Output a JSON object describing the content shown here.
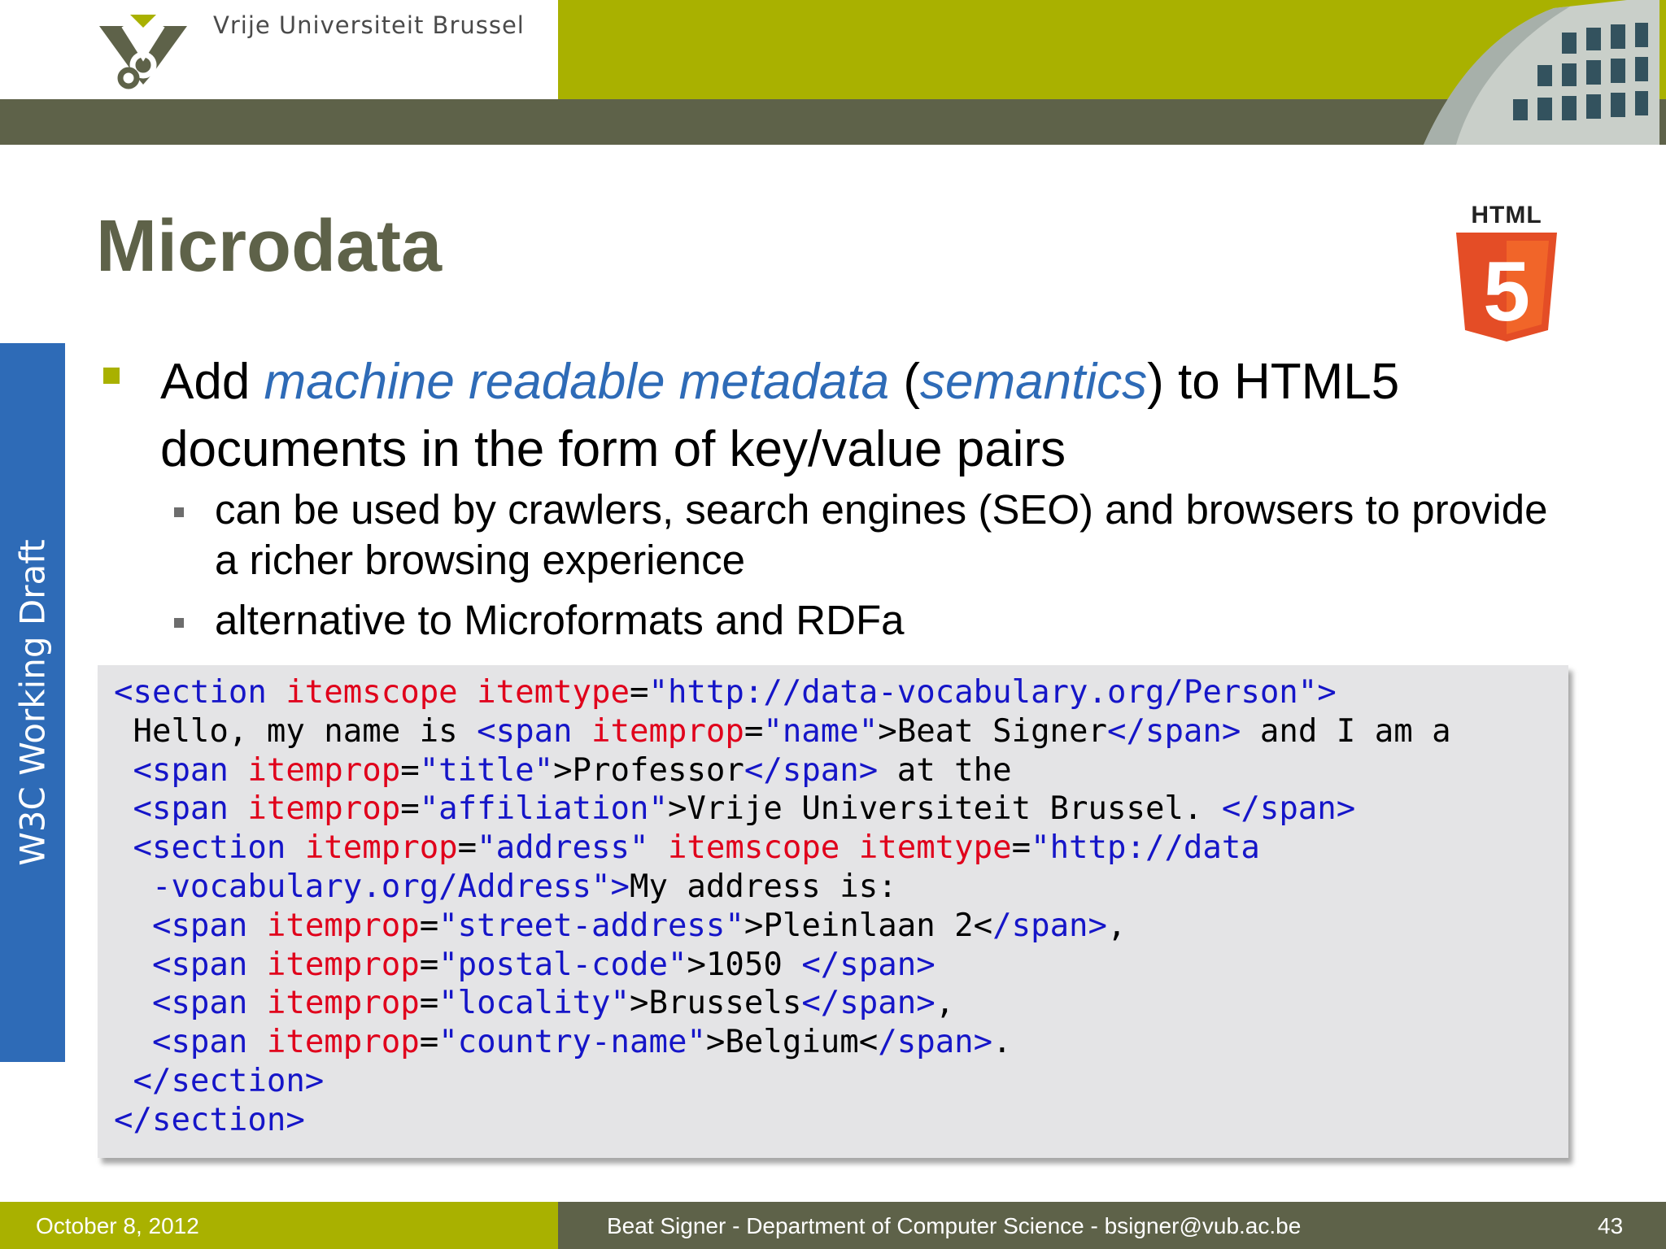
{
  "header": {
    "university_name": "Vrije Universiteit  Brussel",
    "logo_icon": "vub-logo-icon",
    "building_image": "building-photo-icon"
  },
  "slide": {
    "title": "Microdata",
    "side_tab": "W3C Working Draft",
    "html5_logo_text": "HTML",
    "html5_logo_number": "5",
    "bullet": {
      "part1": "Add ",
      "highlight1": "machine readable metadata",
      "part2": " (",
      "highlight2": "semantics",
      "part3": ") to HTML5 documents in the form of key/value pairs"
    },
    "sub_bullets": [
      "can be used by crawlers, search engines (SEO) and browsers to provide a richer browsing experience",
      "alternative to Microformats and RDFa"
    ]
  },
  "code": {
    "line1": [
      "<section ",
      "itemscope ",
      "itemtype",
      "=",
      "\"http://data-vocabulary.org/Person\">"
    ],
    "line2": [
      " Hello, my name is ",
      "<span ",
      "itemprop",
      "=",
      "\"name\"",
      ">Beat Signer",
      "</span>",
      " and I am a"
    ],
    "line3": [
      " ",
      "<span ",
      "itemprop",
      "=",
      "\"title\"",
      ">Professor",
      "</span>",
      " at the"
    ],
    "line4": [
      " ",
      "<span ",
      "itemprop",
      "=",
      "\"affiliation\"",
      ">Vrije Universiteit Brussel. ",
      "</span>"
    ],
    "line5": [
      " ",
      "<section ",
      "itemprop",
      "=",
      "\"address\" ",
      "itemscope ",
      "itemtype",
      "=",
      "\"http://data"
    ],
    "line6": [
      "  ",
      "-vocabulary.org/Address\">",
      "My address is:"
    ],
    "line7": [
      "  ",
      "<span ",
      "itemprop",
      "=",
      "\"street-address\"",
      ">Pleinlaan 2<",
      "/span>",
      ","
    ],
    "line8": [
      "  ",
      "<span ",
      "itemprop",
      "=",
      "\"postal-code\"",
      ">1050 ",
      "</span>"
    ],
    "line9": [
      "  ",
      "<span ",
      "itemprop",
      "=",
      "\"locality\"",
      ">Brussels",
      "</span>",
      ","
    ],
    "line10": [
      "  ",
      "<span ",
      "itemprop",
      "=",
      "\"country-name\"",
      ">Belgium<",
      "/span>",
      "."
    ],
    "line11": [
      " ",
      "</section>"
    ],
    "line12": [
      "</section>"
    ]
  },
  "footer": {
    "date": "October 8, 2012",
    "author": "Beat Signer - Department of Computer Science - bsigner@vub.ac.be",
    "page": "43"
  },
  "colors": {
    "olive": "#a9b100",
    "dark_olive": "#5e6249",
    "blue": "#2e6bb7",
    "code_tag": "#1515c8",
    "code_attr": "#e0001b",
    "html5_orange": "#e44d26"
  }
}
